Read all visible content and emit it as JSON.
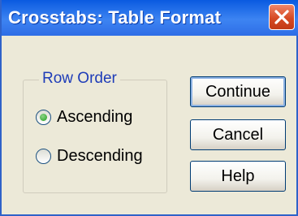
{
  "window": {
    "title": "Crosstabs: Table Format"
  },
  "row_order": {
    "group_label": "Row Order",
    "options": [
      {
        "label": "Ascending",
        "selected": true
      },
      {
        "label": "Descending",
        "selected": false
      }
    ]
  },
  "buttons": {
    "continue_label": "Continue",
    "cancel_label": "Cancel",
    "help_label": "Help"
  },
  "icons": {
    "close": "close-icon"
  },
  "colors": {
    "titlebar": "#2E6DE6",
    "close_button": "#D64A24",
    "dialog_background": "#ECE9D8",
    "group_label": "#1E3CB8",
    "radio_selected": "#21A121"
  }
}
